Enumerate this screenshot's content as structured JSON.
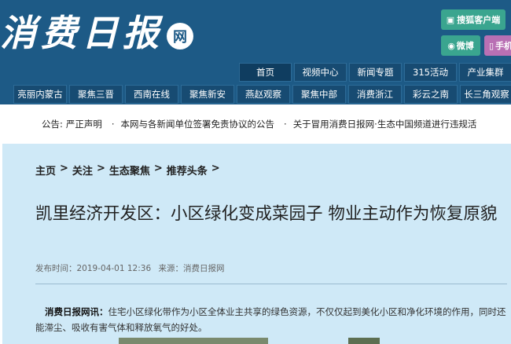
{
  "header": {
    "logo_text": "消费日报",
    "logo_badge": "网",
    "client_button": "搜狐客户端",
    "weibo_button": "微博",
    "mobile_button": "手机"
  },
  "nav": {
    "row1": [
      "首页",
      "视频中心",
      "新闻专题",
      "315活动",
      "产业集群"
    ],
    "row2": [
      "亮丽内蒙古",
      "聚焦三晋",
      "西南在线",
      "聚焦新安",
      "燕赵观察",
      "聚焦中部",
      "消费浙江",
      "彩云之南",
      "长三角观察"
    ]
  },
  "notice": {
    "label": "公告:",
    "items": [
      "严正声明",
      "本网与各新闻单位签署免责协议的公告",
      "关于冒用消费日报网·生态中国频道进行违规活"
    ]
  },
  "breadcrumb": [
    "主页",
    ">",
    "关注",
    ">",
    "生态聚焦",
    ">",
    "推荐头条",
    ">"
  ],
  "article": {
    "title": "凯里经济开发区：小区绿化变成菜园子 物业主动作为恢复原貌",
    "publish_label": "发布时间：",
    "publish_time": "2019-04-01 12:36",
    "source_label": "来源：",
    "source": "消费日报网",
    "lead": "消费日报网讯：",
    "body": "住宅小区绿化带作为小区全体业主共享的绿色资源，不仅仅起到美化小区和净化环境的作用，同时还能滞尘、吸收有害气体和释放氧气的好处。"
  }
}
